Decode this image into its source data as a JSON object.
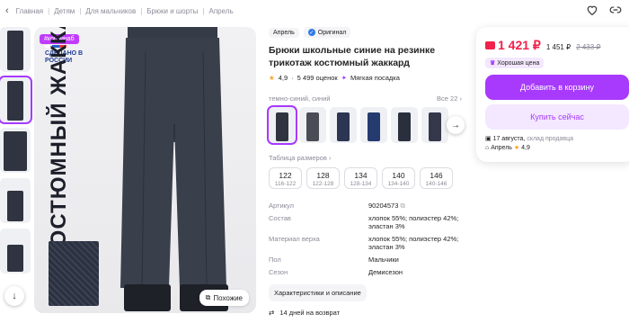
{
  "breadcrumbs": [
    "Главная",
    "Детям",
    "Для мальчиков",
    "Брюки и шорты",
    "Апрель"
  ],
  "image": {
    "promo_tag": "#корзинаб",
    "made_in": "СДЕЛАНО В РОССИИ",
    "vertical_text": "КОСТЮМНЫЙ ЖАККАРД",
    "similar_label": "Похожие"
  },
  "product": {
    "brand": "Апрель",
    "original_label": "Оригинал",
    "title": "Брюки школьные синие на резинке трикотаж костюмный жаккард",
    "rating": "4,9",
    "reviews": "5 499 оценок",
    "fit_label": "Мягкая посадка",
    "color_label": "темно-синий, синий",
    "all_colors": "Все 22",
    "size_table_label": "Таблица размеров",
    "sizes": [
      {
        "size": "122",
        "range": "116-122"
      },
      {
        "size": "128",
        "range": "122-128"
      },
      {
        "size": "134",
        "range": "128-134"
      },
      {
        "size": "140",
        "range": "134-140"
      },
      {
        "size": "146",
        "range": "140-146"
      }
    ],
    "specs": [
      {
        "k": "Артикул",
        "v": "90204573"
      },
      {
        "k": "Состав",
        "v": "хлопок 55%; полиэстер 42%; эластан 3%"
      },
      {
        "k": "Материал верха",
        "v": "хлопок 55%; полиэстер 42%; эластан 3%"
      },
      {
        "k": "Пол",
        "v": "Мальчики"
      },
      {
        "k": "Сезон",
        "v": "Демисезон"
      }
    ],
    "chars_button": "Характеристики и описание",
    "return_policy": "14 дней на возврат"
  },
  "buy": {
    "price_wallet": "1 421 ₽",
    "price": "1 451 ₽",
    "price_old": "2 433 ₽",
    "good_price": "Хорошая цена",
    "add_to_cart": "Добавить в корзину",
    "buy_now": "Купить сейчас",
    "delivery_date": "17 августа,",
    "delivery_from": "склад продавца",
    "seller": "Апрель",
    "seller_rating": "4,9"
  },
  "colors": {
    "accent": "#a73afd",
    "price": "#f0214b",
    "swatches": [
      "#2f3440",
      "#4a4d55",
      "#2c3552",
      "#253a6e",
      "#2a2f3d",
      "#34384a"
    ]
  }
}
